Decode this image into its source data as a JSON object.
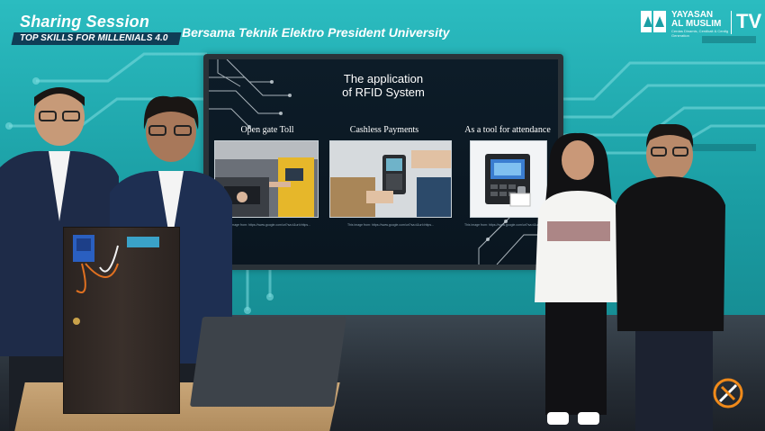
{
  "banner": {
    "title": "Sharing Session",
    "subtitle": "TOP SKILLS FOR MILLENIALS 4.0",
    "tagline": "Bersama Teknik Elektro President University"
  },
  "logo": {
    "name_line1": "YAYASAN",
    "name_line2": "AL MUSLIM",
    "tagline": "Cerdas Dinamis, Cerdikait & Cerdig Generation",
    "tv": "TV"
  },
  "slide": {
    "title_line1": "The application",
    "title_line2": "of RFID System",
    "columns": [
      {
        "title": "Open gate Toll",
        "caption": "This image from: https://www.google.com/url?sa=i&url=https..."
      },
      {
        "title": "Cashless Payments",
        "caption": "This image from: https://www.google.com/url?sa=i&url=https..."
      },
      {
        "title": "As a tool for attendance",
        "caption": "This image from: https://www.google.com/url?sa=i&url=https..."
      }
    ]
  },
  "colors": {
    "background_top": "#2bbcc0",
    "background_bottom": "#127f86",
    "banner_strip": "#0f3d56",
    "slide_bg": "#0d1c28",
    "floor": "#262d35"
  }
}
